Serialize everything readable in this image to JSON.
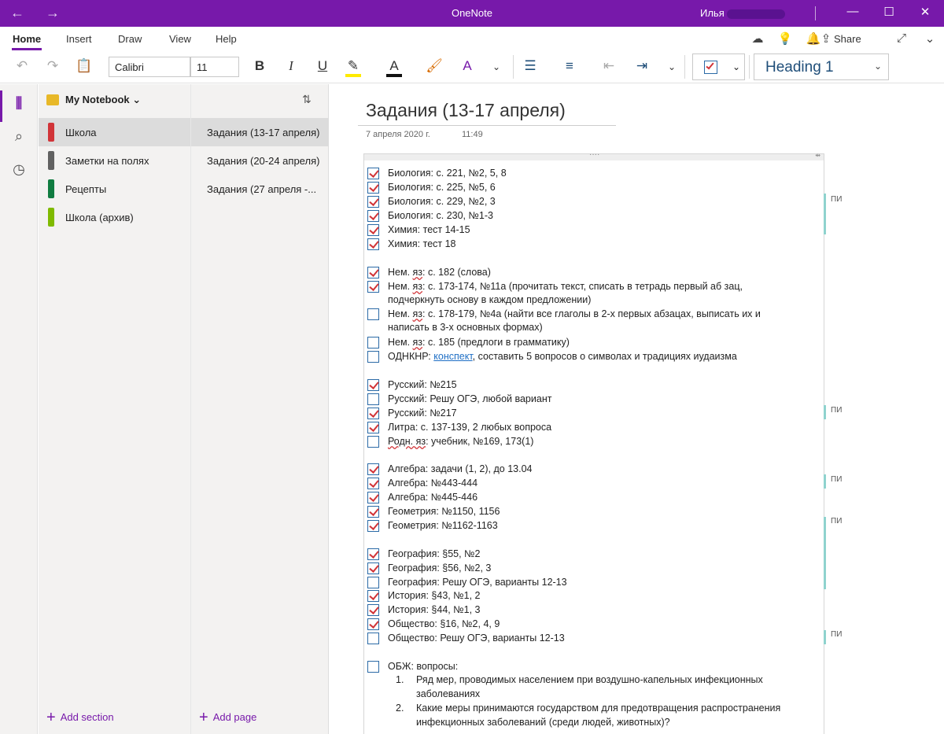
{
  "titlebar": {
    "app_title": "OneNote",
    "user": "Илья",
    "back_icon": "←",
    "forward_icon": "→",
    "minimize_icon": "—",
    "maximize_icon": "☐",
    "close_icon": "✕"
  },
  "menu": {
    "tabs": [
      "Home",
      "Insert",
      "Draw",
      "View",
      "Help"
    ],
    "share_label": "Share"
  },
  "toolbar": {
    "font": "Calibri",
    "size": "11",
    "bold": "B",
    "italic": "I",
    "underline": "U",
    "style": "Heading 1"
  },
  "notebook": {
    "name": "My Notebook",
    "sections": [
      {
        "label": "Школа",
        "color": "#d13438"
      },
      {
        "label": "Заметки на полях",
        "color": "#616161"
      },
      {
        "label": "Рецепты",
        "color": "#107c41"
      },
      {
        "label": "Школа (архив)",
        "color": "#7fba00"
      }
    ],
    "add_section": "Add section"
  },
  "pages": {
    "items": [
      "Задания (13-17 апреля)",
      "Задания (20-24 апреля)",
      "Задания (27 апреля -..."
    ],
    "add_page": "Add page"
  },
  "page": {
    "title": "Задания (13-17 апреля)",
    "date": "7 апреля 2020 г.",
    "time": "11:49",
    "container_handle": "····",
    "tasks": [
      {
        "checked": true,
        "text": "Биология: с. 221, №2, 5, 8"
      },
      {
        "checked": true,
        "text": "Биология: с. 225, №5, 6"
      },
      {
        "checked": true,
        "text": "Биология: с. 229, №2, 3"
      },
      {
        "checked": true,
        "text": "Биология: с. 230, №1-3"
      },
      {
        "checked": true,
        "text": "Химия: тест 14-15"
      },
      {
        "checked": true,
        "text": "Химия: тест 18"
      },
      {
        "checked": true,
        "pre": "Нем. ",
        "sq": "яз",
        "post": ": с. 182 (слова)"
      },
      {
        "checked": true,
        "pre": "Нем. ",
        "sq": "яз",
        "post": ": с. 173-174, №11а (прочитать текст, списать в тетрадь первый аб  зац,"
      },
      {
        "checked": false,
        "pre": "Нем. ",
        "sq": "яз",
        "post": ": с. 178-179, №4а (найти все глаголы в 2-х первых абзацах,  выписать их и"
      },
      {
        "checked": false,
        "pre": "Нем. ",
        "sq": "яз",
        "post": ": с. 185 (предлоги в грамматику)"
      },
      {
        "checked": false,
        "pre": "ОДНКНР: ",
        "link": "конспект",
        "post": ", составить 5 вопросов о символах и традициях иудаизма"
      },
      {
        "checked": true,
        "text": "Русский: №215"
      },
      {
        "checked": false,
        "text": "Русский: Решу ОГЭ, любой вариант"
      },
      {
        "checked": true,
        "text": "Русский: №217"
      },
      {
        "checked": true,
        "text": "Литра: с. 137-139, 2 любых вопроса"
      },
      {
        "checked": false,
        "sq": "Родн. яз",
        "post": ": учебник, №169, 173(1)"
      },
      {
        "checked": true,
        "text": "Алгебра: задачи (1, 2), до 13.04"
      },
      {
        "checked": true,
        "text": "Алгебра: №443-444"
      },
      {
        "checked": true,
        "text": "Алгебра: №445-446"
      },
      {
        "checked": true,
        "text": "Геометрия: №1150, 1156"
      },
      {
        "checked": true,
        "text": "Геометрия: №1162-1163"
      },
      {
        "checked": true,
        "text": "География: §55, №2"
      },
      {
        "checked": true,
        "text": "География: §56, №2, 3"
      },
      {
        "checked": false,
        "text": "География: Решу ОГЭ, варианты 12-13"
      },
      {
        "checked": true,
        "text": "История: §43, №1, 2"
      },
      {
        "checked": true,
        "text": "История: §44, №1, 3"
      },
      {
        "checked": true,
        "text": "Общество: §16, №2, 4, 9"
      },
      {
        "checked": false,
        "text": "Общество: Решу ОГЭ, варианты 12-13"
      },
      {
        "checked": false,
        "text": "ОБЖ: вопросы:"
      }
    ],
    "continuations": [
      "подчеркнуть основу в каждом предложении)",
      "написать в 3-х основных формах)"
    ],
    "obzh_items": [
      {
        "n": "1.",
        "line1": "Ряд мер, проводимых населением при воздушно-капельных инфекционных",
        "line2": "заболеваниях"
      },
      {
        "n": "2.",
        "line1": "Какие меры принимаются государством для предотвращения распространения",
        "line2": "инфекционных заболеваний (среди людей, животных)?"
      }
    ],
    "author_initials": "ПИ"
  }
}
